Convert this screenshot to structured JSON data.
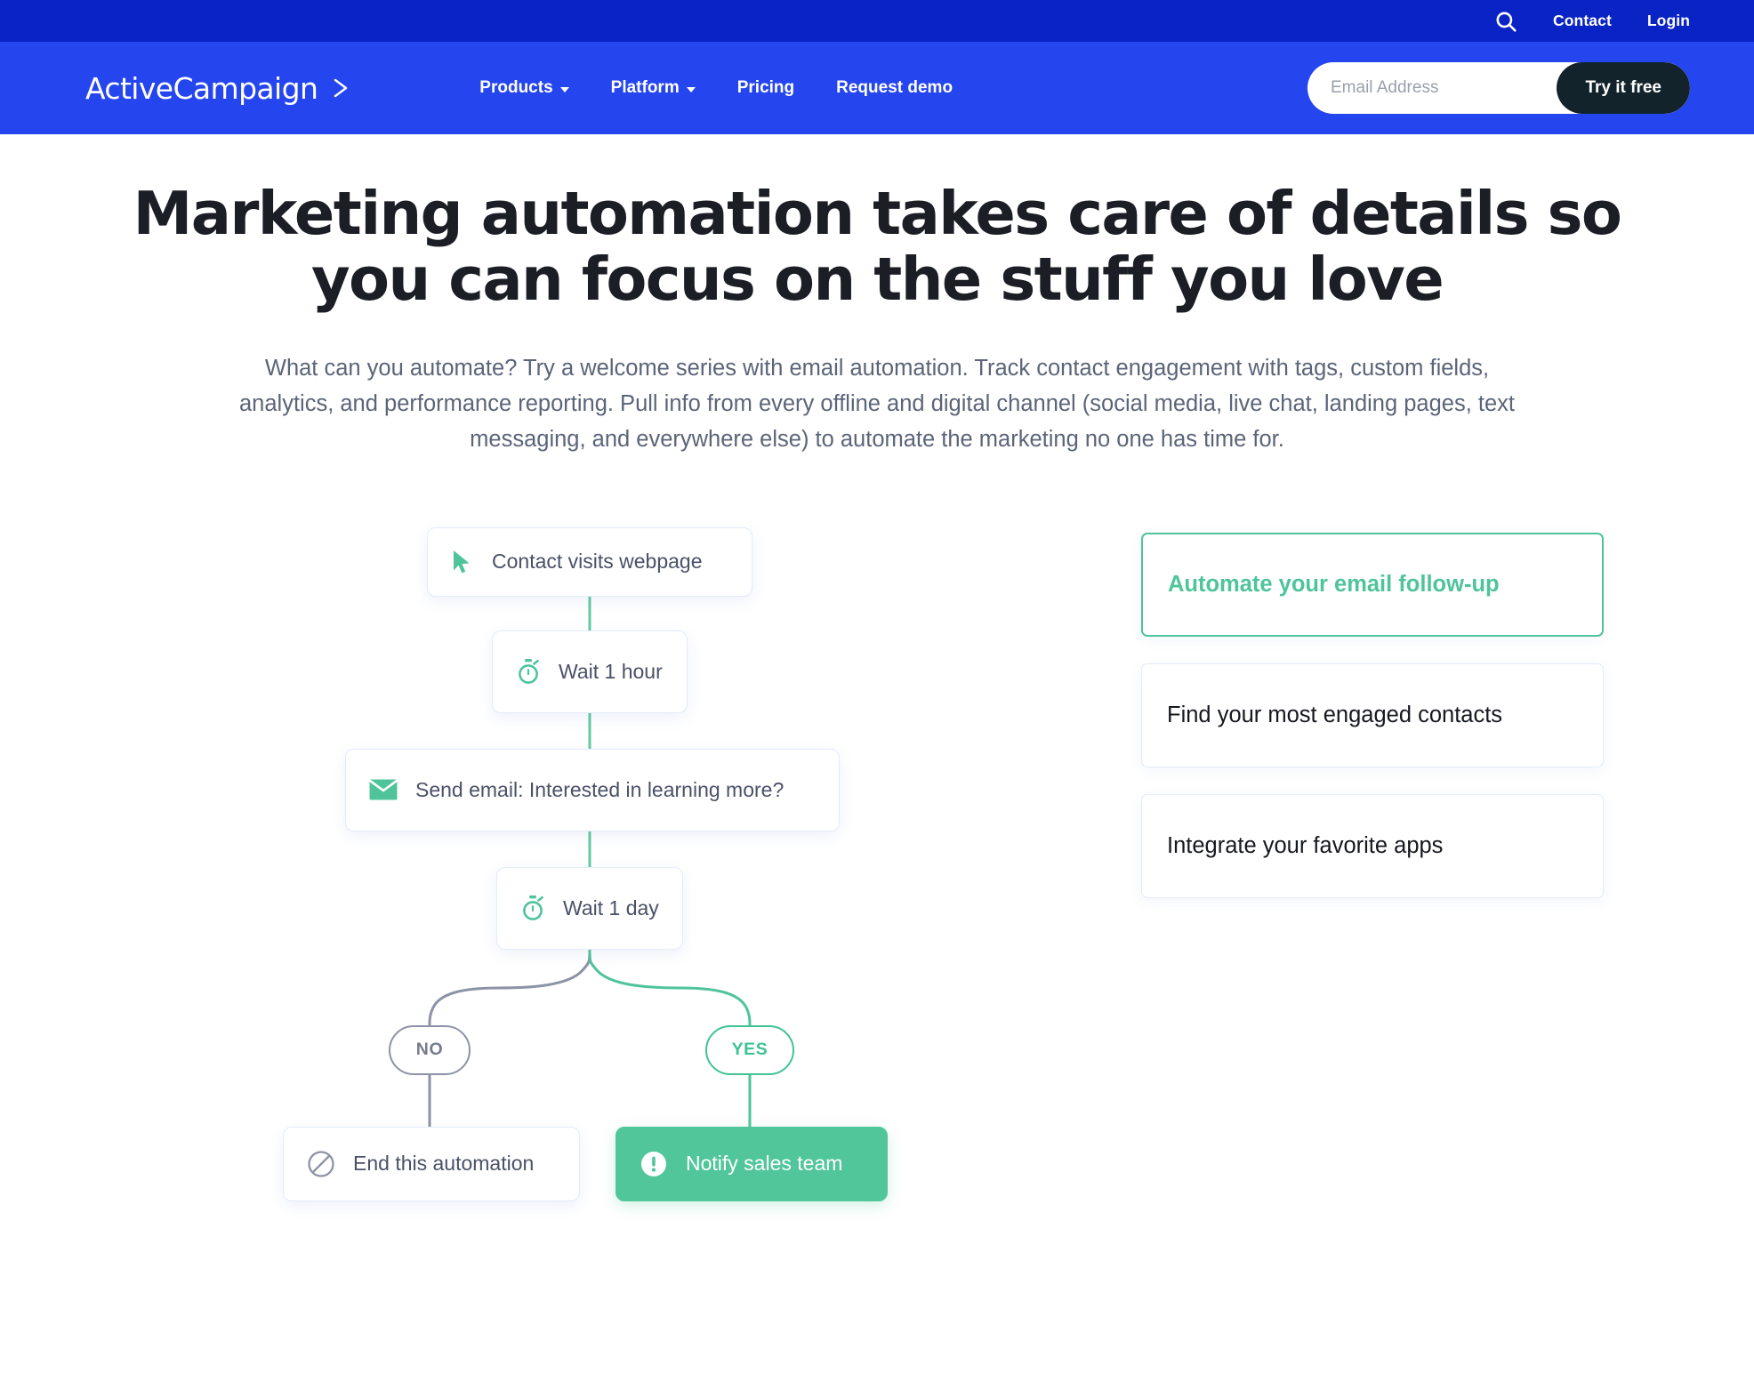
{
  "topbar": {
    "search_icon": "search-icon",
    "links": [
      {
        "label": "Contact"
      },
      {
        "label": "Login"
      }
    ]
  },
  "navbar": {
    "logo_text": "ActiveCampaign",
    "logo_chevron_icon": "chevron-right-icon",
    "links": [
      {
        "label": "Products",
        "has_caret": true
      },
      {
        "label": "Platform",
        "has_caret": true
      },
      {
        "label": "Pricing",
        "has_caret": false
      },
      {
        "label": "Request demo",
        "has_caret": false
      }
    ],
    "email_placeholder": "Email Address",
    "email_value": "",
    "cta_label": "Try it free"
  },
  "hero": {
    "headline": "Marketing automation takes care of details so you can focus on the stuff you love",
    "subcopy": "What can you automate? Try a welcome series with email automation. Track contact engagement with tags, custom fields, analytics, and performance reporting. Pull info from every offline and digital channel (social media, live chat, landing pages, text messaging, and everywhere else) to automate the marketing no one has time for."
  },
  "flow": {
    "nodes": [
      {
        "id": "trigger",
        "label": "Contact visits webpage",
        "icon": "cursor-arrow-icon",
        "style": "white"
      },
      {
        "id": "wait1",
        "label": "Wait 1 hour",
        "icon": "stopwatch-icon",
        "style": "white"
      },
      {
        "id": "sendemail",
        "label": "Send email: Interested in learning more?",
        "icon": "envelope-icon",
        "style": "white"
      },
      {
        "id": "wait2",
        "label": "Wait 1 day",
        "icon": "stopwatch-icon",
        "style": "white"
      },
      {
        "id": "endauto",
        "label": "End this automation",
        "icon": "prohibition-icon",
        "style": "white"
      },
      {
        "id": "notify",
        "label": "Notify sales team",
        "icon": "exclamation-circle-icon",
        "style": "green"
      }
    ],
    "branch_labels": [
      {
        "id": "no",
        "label": "NO"
      },
      {
        "id": "yes",
        "label": "YES"
      }
    ]
  },
  "accordion": {
    "items": [
      {
        "label": "Automate your email follow-up",
        "active": true
      },
      {
        "label": "Find your most engaged contacts",
        "active": false
      },
      {
        "label": "Integrate your favorite apps",
        "active": false
      }
    ]
  },
  "colors": {
    "topbar_blue": "#0A23C4",
    "nav_blue": "#2545EF",
    "cta_dark": "#13232B",
    "accent_green": "#50C69A",
    "text_dark": "#1C1E26",
    "text_muted": "#5B6478",
    "node_border": "#E4EBFA",
    "branch_gray": "#8D93A6"
  }
}
